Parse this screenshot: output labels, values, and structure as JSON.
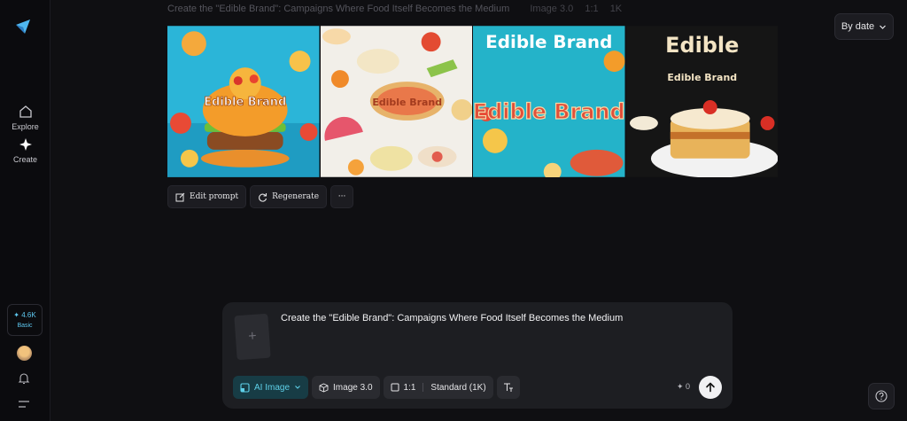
{
  "sidebar": {
    "items": [
      {
        "label": "Explore",
        "icon": "home-icon"
      },
      {
        "label": "Create",
        "icon": "sparkle-icon"
      }
    ],
    "credits": {
      "amount": "✦ 4.6K",
      "plan": "Basic"
    }
  },
  "header": {
    "prompt": "Create the \"Edible Brand\": Campaigns Where Food Itself Becomes the Medium",
    "model": "Image 3.0",
    "ratio": "1:1",
    "resolution": "1K",
    "sort_label": "By date"
  },
  "gallery": {
    "images": [
      {
        "caption": "Edible Brand",
        "colors": [
          "#2bb5d8",
          "#f39c2a"
        ]
      },
      {
        "caption": "Edible Brand",
        "colors": [
          "#f2efe9",
          "#e76a3b"
        ]
      },
      {
        "caption": "Edible Brand",
        "colors": [
          "#24b3c9",
          "#e05a3a"
        ]
      },
      {
        "caption": "Edible Brand",
        "colors": [
          "#151515",
          "#f3e4c4"
        ]
      }
    ]
  },
  "actions": {
    "edit_prompt": "Edit prompt",
    "regenerate": "Regenerate",
    "more": "···"
  },
  "composer": {
    "thumb_plus": "+",
    "prompt_text": "Create the \"Edible Brand\": Campaigns Where Food Itself Becomes the Medium",
    "mode": "AI Image",
    "model": "Image 3.0",
    "ratio": "1:1",
    "quality": "Standard (1K)",
    "cost": "✦ 0"
  },
  "colors": {
    "accent": "#5ed0e8",
    "background": "#0f0f12"
  }
}
